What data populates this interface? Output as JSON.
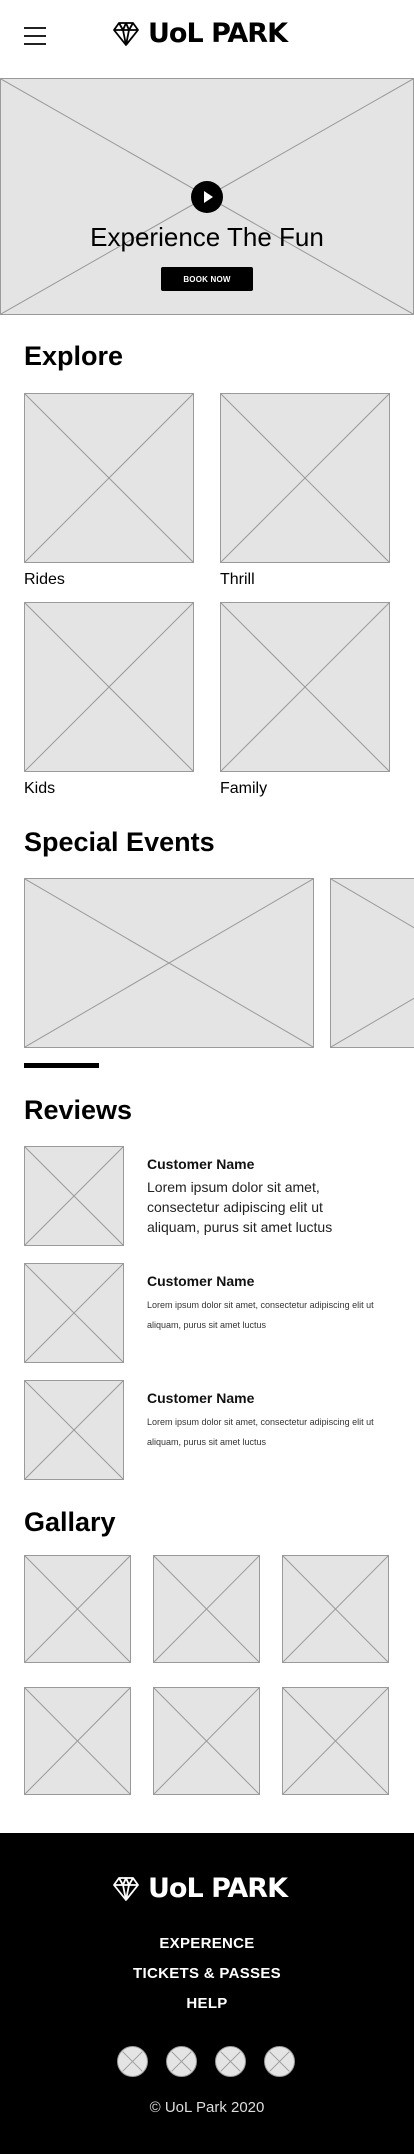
{
  "header": {
    "brand": "UoL PARK",
    "menu_icon": "hamburger-menu-icon",
    "logo_icon": "diamond-icon"
  },
  "hero": {
    "title": "Experience The Fun",
    "cta_label": "BOOK NOW",
    "play_icon": "play-icon"
  },
  "explore": {
    "title": "Explore",
    "items": [
      {
        "label": "Rides"
      },
      {
        "label": "Thrill"
      },
      {
        "label": "Kids"
      },
      {
        "label": "Family"
      }
    ]
  },
  "events": {
    "title": "Special Events"
  },
  "reviews": {
    "title": "Reviews",
    "items": [
      {
        "name": "Customer Name",
        "text": "Lorem ipsum dolor sit amet, consectetur adipiscing elit ut aliquam, purus sit amet luctus"
      },
      {
        "name": "Customer Name",
        "text": "Lorem ipsum dolor sit amet, consectetur adipiscing elit ut aliquam, purus sit amet luctus"
      },
      {
        "name": "Customer Name",
        "text": "Lorem ipsum dolor sit amet, consectetur adipiscing elit ut aliquam, purus sit amet luctus"
      }
    ]
  },
  "gallery": {
    "title": "Gallary"
  },
  "footer": {
    "brand": "UoL PARK",
    "links": [
      "EXPERENCE",
      "TICKETS & PASSES",
      "HELP"
    ],
    "copyright": "© UoL Park 2020"
  },
  "colors": {
    "background": "#ffffff",
    "footer": "#000000",
    "placeholder": "#e4e4e4",
    "accent": "#000000"
  }
}
